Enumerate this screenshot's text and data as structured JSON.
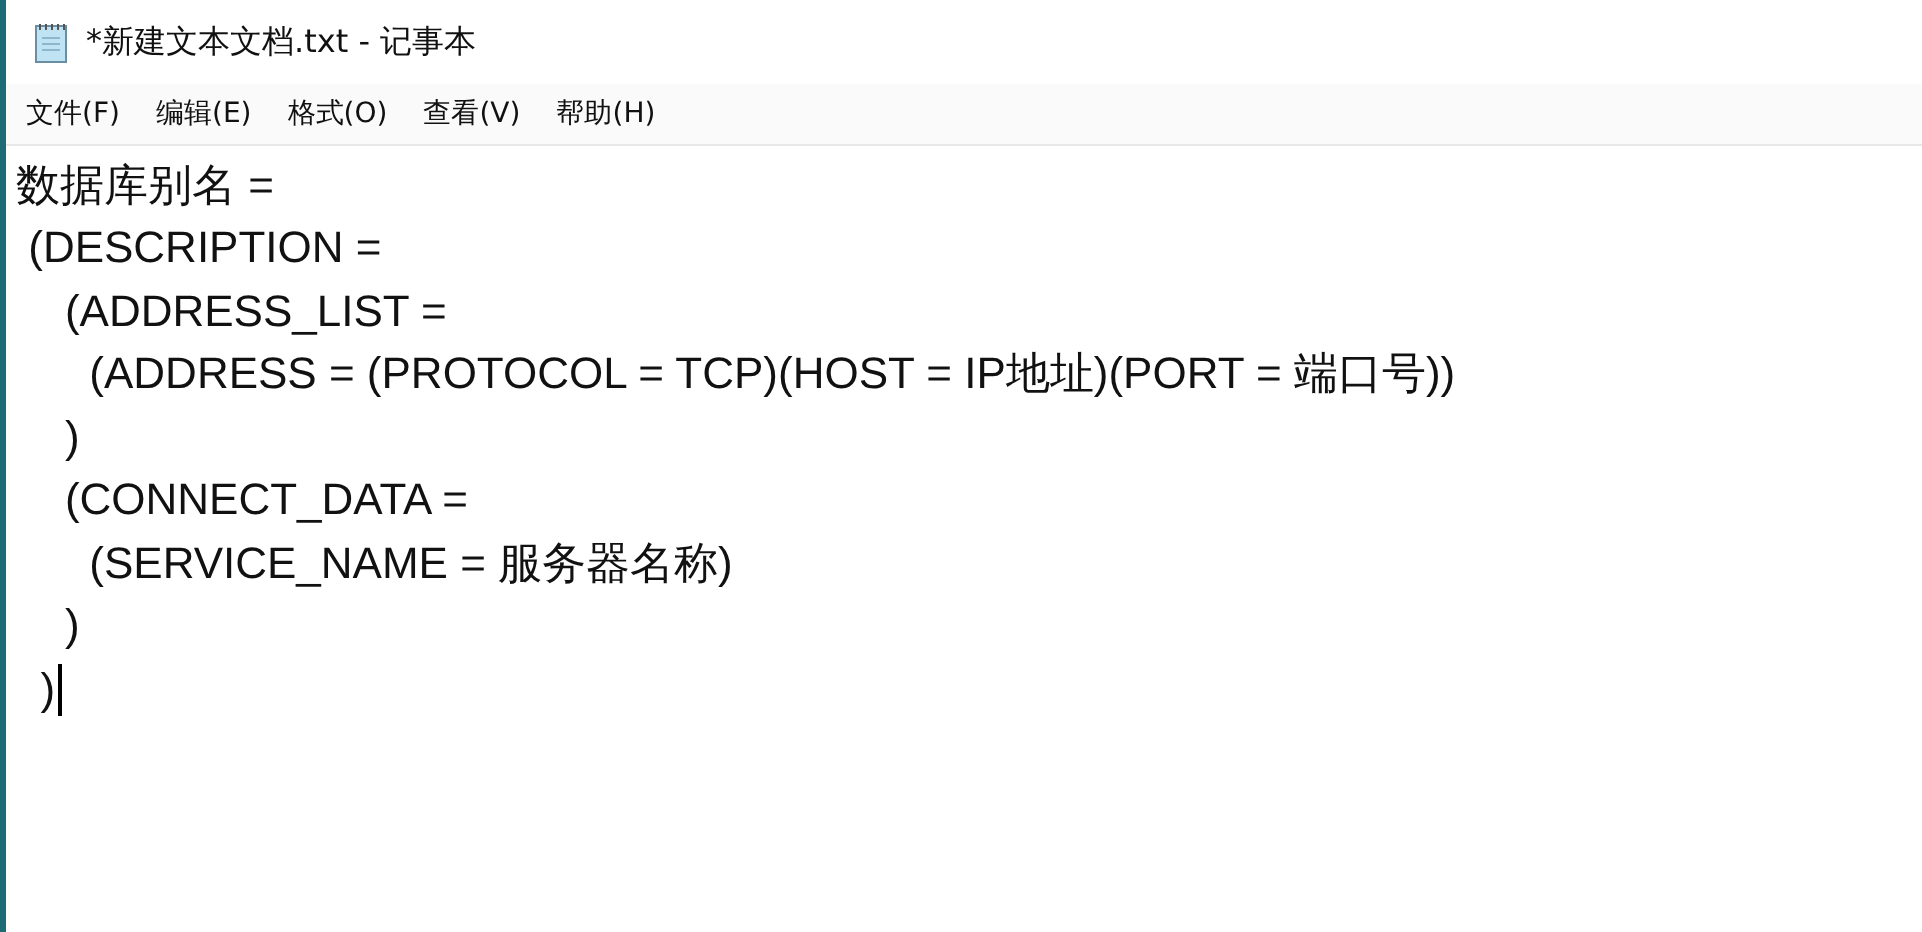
{
  "window": {
    "title": "*新建文本文档.txt - 记事本"
  },
  "menu": [
    {
      "label": "文件(F)"
    },
    {
      "label": "编辑(E)"
    },
    {
      "label": "格式(O)"
    },
    {
      "label": "查看(V)"
    },
    {
      "label": "帮助(H)"
    }
  ],
  "editor": {
    "lines": [
      "数据库别名 =",
      " (DESCRIPTION =",
      "    (ADDRESS_LIST =",
      "      (ADDRESS = (PROTOCOL = TCP)(HOST = IP地址)(PORT = 端口号))",
      "    )",
      "    (CONNECT_DATA =",
      "      (SERVICE_NAME = 服务器名称)",
      "    )",
      "  )"
    ]
  }
}
